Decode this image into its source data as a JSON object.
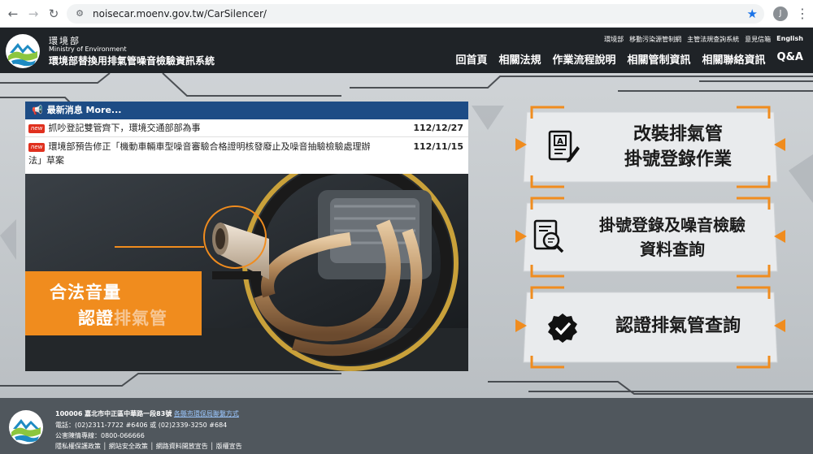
{
  "browser": {
    "url": "noisecar.moenv.gov.tw/CarSilencer/",
    "profile_initial": "J"
  },
  "header": {
    "org_zh": "環境部",
    "org_en": "Ministry of Environment",
    "site_title": "環境部替換用排氣管噪音檢驗資訊系統",
    "top_links": [
      "環境部",
      "移動污染源管制網",
      "主管法規查詢系統",
      "意見信箱",
      "English"
    ],
    "nav": [
      "回首頁",
      "相關法規",
      "作業流程說明",
      "相關管制資訊",
      "相關聯絡資訊",
      "Q&A"
    ]
  },
  "news": {
    "heading": "最新消息 More...",
    "badge": "new",
    "items": [
      {
        "title": "抓吵登記雙管齊下，環境交通部部為事",
        "date": "112/12/27"
      },
      {
        "title_line1": "環境部預告修正「機動車輛車型噪音審驗合格證明核發廢止及噪音抽驗檢驗處理辦",
        "title_line2": "法」草案",
        "date": "112/11/15"
      }
    ]
  },
  "hero": {
    "line1": "合法音量",
    "line2_a": "認證",
    "line2_b": "排氣管"
  },
  "cards": [
    {
      "line1": "改裝排氣管",
      "line2": "掛號登錄作業",
      "icon": "document-edit-icon"
    },
    {
      "line1": "掛號登錄及噪音檢驗",
      "line2": "資料查詢",
      "icon": "document-search-icon"
    },
    {
      "line1": "認證排氣管查詢",
      "line2": "",
      "icon": "certified-badge-icon"
    }
  ],
  "footer": {
    "address": "100006 嘉北市中正區中華路一段83號",
    "map_link": "各縣市環保局聯繫方式",
    "phone": "電話：(02)2311-7722 #6406 或 (02)2339-3250 #684",
    "hotline": "公害陳情專線：0800-066666",
    "policies": "隱私權保護政策 │ 網站安全政策 │ 網路資料開放宣告 │ 版權宣告"
  },
  "colors": {
    "header_bg": "#1f2327",
    "news_head_bg": "#1d4c85",
    "accent_orange": "#f08c1e",
    "footer_bg": "#50575d"
  }
}
